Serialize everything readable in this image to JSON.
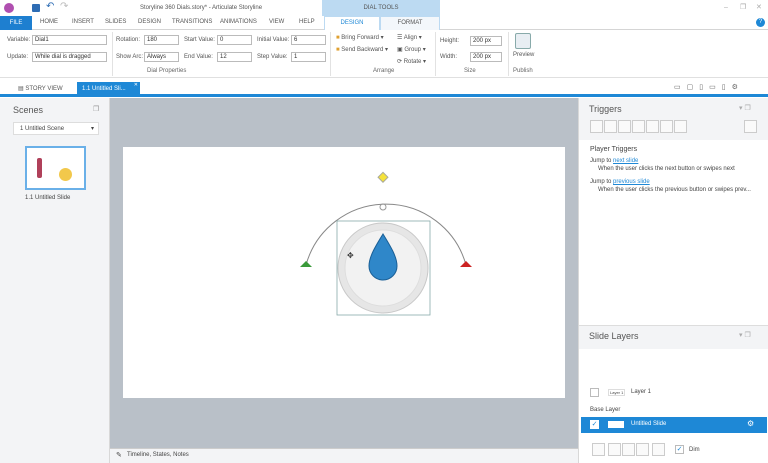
{
  "title": "Storyline 360 Dials.story* - Articulate Storyline",
  "contextual_group": "DIAL TOOLS",
  "menu_tabs": [
    "FILE",
    "HOME",
    "INSERT",
    "SLIDES",
    "DESIGN",
    "TRANSITIONS",
    "ANIMATIONS",
    "VIEW",
    "HELP"
  ],
  "context_tabs": [
    "DESIGN",
    "FORMAT"
  ],
  "dial": {
    "variable_label": "Variable:",
    "variable": "Dial1",
    "update_label": "Update:",
    "update": "While dial is dragged",
    "rotation_label": "Rotation:",
    "rotation": "180",
    "show_arc_label": "Show Arc:",
    "show_arc": "Always",
    "start_label": "Start Value:",
    "start": "0",
    "end_label": "End Value:",
    "end": "12",
    "initial_label": "Initial Value:",
    "initial": "6",
    "step_label": "Step Value:",
    "step": "1",
    "group": "Dial Properties"
  },
  "arrange": {
    "bring_forward": "Bring Forward",
    "send_backward": "Send Backward",
    "align": "Align",
    "group_btn": "Group",
    "rotate": "Rotate",
    "group": "Arrange"
  },
  "size": {
    "height_label": "Height:",
    "height": "200 px",
    "width_label": "Width:",
    "width": "200 px",
    "group": "Size"
  },
  "publish": {
    "preview": "Preview",
    "group": "Publish"
  },
  "doc_tabs": {
    "story_view": "STORY VIEW",
    "slide_tab": "1.1 Untitled Sli..."
  },
  "scenes": {
    "title": "Scenes",
    "selected": "1 Untitled Scene",
    "slide_caption": "1.1 Untitled Slide"
  },
  "bottom_bar": "Timeline, States, Notes",
  "triggers": {
    "title": "Triggers",
    "section": "Player Triggers",
    "items": [
      {
        "prefix": "Jump to ",
        "link": "next slide",
        "desc": "When the user clicks the next button or swipes next"
      },
      {
        "prefix": "Jump to ",
        "link": "previous slide",
        "desc": "When the user clicks the previous button or swipes prev..."
      }
    ]
  },
  "layers": {
    "title": "Slide Layers",
    "layer1_thumb": "Layer 1",
    "layer1": "Layer 1",
    "base_label": "Base Layer",
    "base": "Untitled Slide",
    "dim": "Dim"
  },
  "colors": {
    "accent": "#1e88d6",
    "file": "#1e7fd0"
  }
}
